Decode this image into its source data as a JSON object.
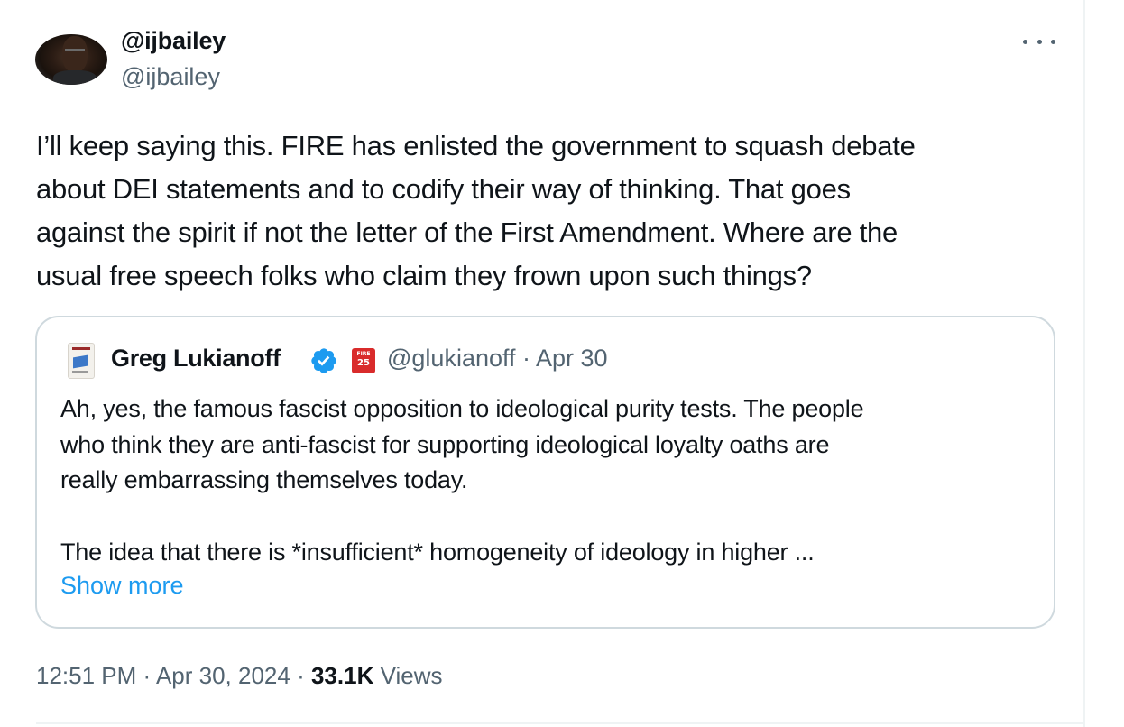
{
  "author": {
    "display_name": "@ijbailey",
    "handle": "@ijbailey"
  },
  "tweet": {
    "lines": [
      "I’ll keep saying this. FIRE has enlisted the government to squash debate",
      "about DEI statements and to codify their way of thinking. That goes",
      "against the spirit if not the letter of the First Amendment. Where are the",
      "usual free speech folks who claim they frown upon such things?"
    ]
  },
  "quoted": {
    "name": "Greg Lukianoff",
    "meta": "@glukianoff · Apr 30",
    "affiliate_badge": {
      "line1": "FIRE",
      "line2": "25"
    },
    "paragraph1": [
      "Ah, yes, the famous fascist opposition to ideological purity tests. The people",
      "who think they are anti-fascist for supporting ideological loyalty oaths are",
      "really embarrassing themselves today."
    ],
    "paragraph2": [
      "The idea that there is *insufficient* homogeneity of ideology in higher ..."
    ],
    "show_more": "Show more"
  },
  "footer": {
    "timestamp": "12:51 PM · Apr 30, 2024 · ",
    "views_count": "33.1K",
    "views_label": " Views"
  },
  "icons": {
    "more": "more-icon",
    "verified": "verified-badge-icon",
    "affiliate": "fire-affiliate-icon"
  },
  "colors": {
    "text_primary": "#0f1419",
    "text_secondary": "#536471",
    "link": "#1d9bf0",
    "verified": "#1d9bf0",
    "border": "#cfd9de",
    "affiliate": "#d92b2b"
  }
}
